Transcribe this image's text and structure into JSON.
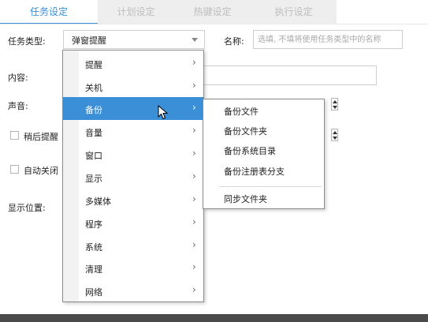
{
  "tabs": [
    {
      "label": "任务设定",
      "active": true
    },
    {
      "label": "计划设定",
      "active": false
    },
    {
      "label": "热键设定",
      "active": false
    },
    {
      "label": "执行设定",
      "active": false
    }
  ],
  "form": {
    "task_type_label": "任务类型:",
    "task_type_value": "弹窗提醒",
    "name_label": "名称:",
    "name_placeholder": "选填, 不填将使用任务类型中的名称",
    "content_label": "内容:",
    "sound_label": "声音:",
    "snooze_label": "稍后提醒",
    "auto_close_label": "自动关闭",
    "display_position_label": "显示位置:"
  },
  "menu": {
    "items": [
      {
        "label": "提醒",
        "has_submenu": true
      },
      {
        "label": "关机",
        "has_submenu": true
      },
      {
        "label": "备份",
        "has_submenu": true,
        "highlighted": true
      },
      {
        "label": "音量",
        "has_submenu": true
      },
      {
        "label": "窗口",
        "has_submenu": true
      },
      {
        "label": "显示",
        "has_submenu": true
      },
      {
        "label": "多媒体",
        "has_submenu": true
      },
      {
        "label": "程序",
        "has_submenu": true
      },
      {
        "label": "系统",
        "has_submenu": true
      },
      {
        "label": "清理",
        "has_submenu": true
      },
      {
        "label": "网络",
        "has_submenu": true
      }
    ],
    "chevron": "›"
  },
  "submenu": {
    "items": [
      {
        "label": "备份文件"
      },
      {
        "label": "备份文件夹"
      },
      {
        "label": "备份系统目录"
      },
      {
        "label": "备份注册表分支"
      },
      {
        "label": "同步文件夹"
      }
    ]
  },
  "colors": {
    "accent": "#3b8fd6",
    "tab_active_text": "#3a8fd8"
  }
}
